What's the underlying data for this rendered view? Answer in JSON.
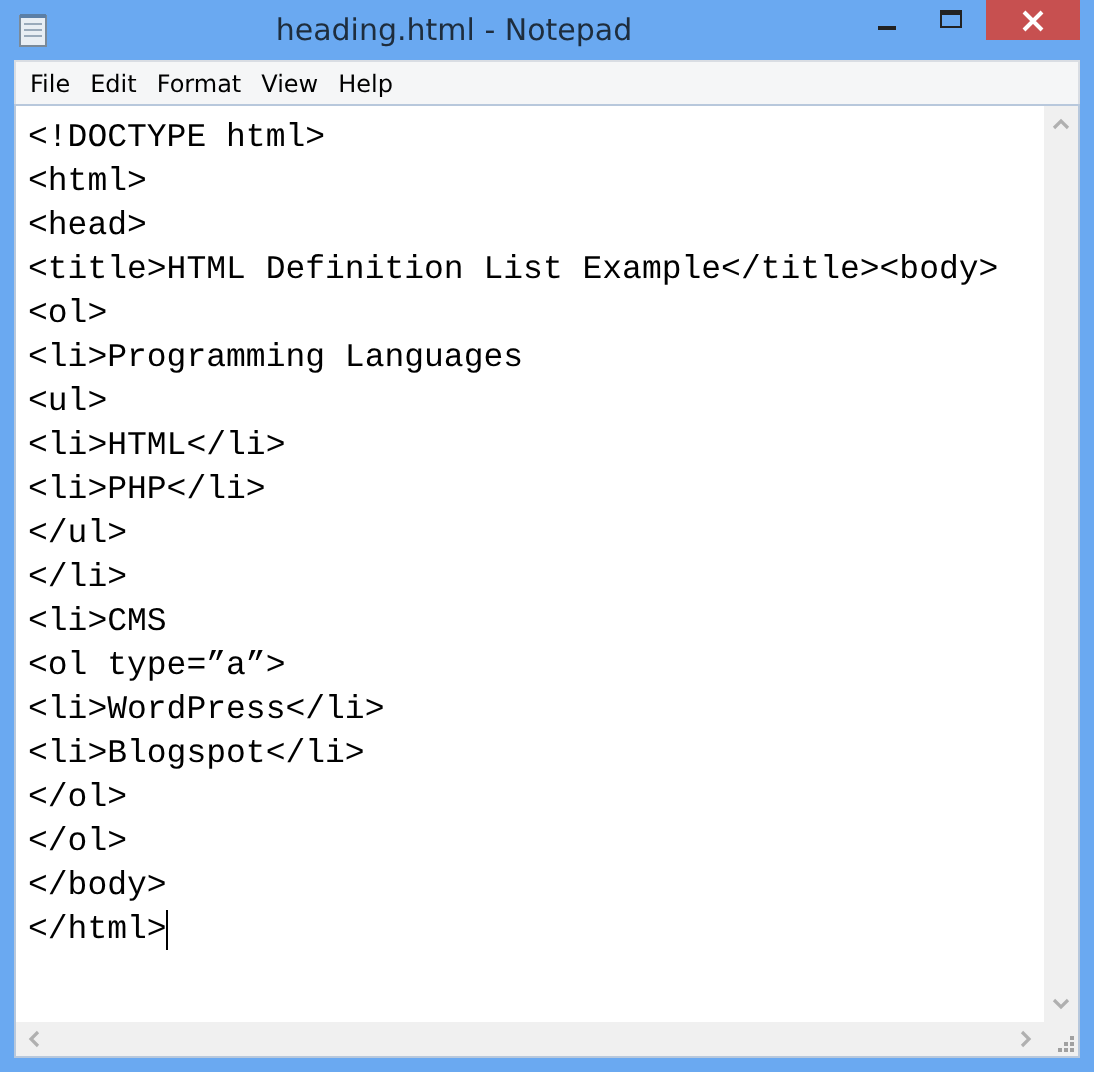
{
  "window": {
    "title": "heading.html - Notepad"
  },
  "menu": [
    "File",
    "Edit",
    "Format",
    "View",
    "Help"
  ],
  "editor": {
    "lines": [
      "<!DOCTYPE html>",
      "<html>",
      "<head>",
      "<title>HTML Definition List Example</title><body>",
      "<ol>",
      "<li>Programming Languages",
      "<ul>",
      "<li>HTML</li>",
      "<li>PHP</li>",
      "</ul>",
      "</li>",
      "<li>CMS",
      "<ol type=”a”>",
      "<li>WordPress</li>",
      "<li>Blogspot</li>",
      "</ol>",
      "</ol>",
      "</body>",
      "</html>"
    ],
    "caret_after_last_line": true
  }
}
